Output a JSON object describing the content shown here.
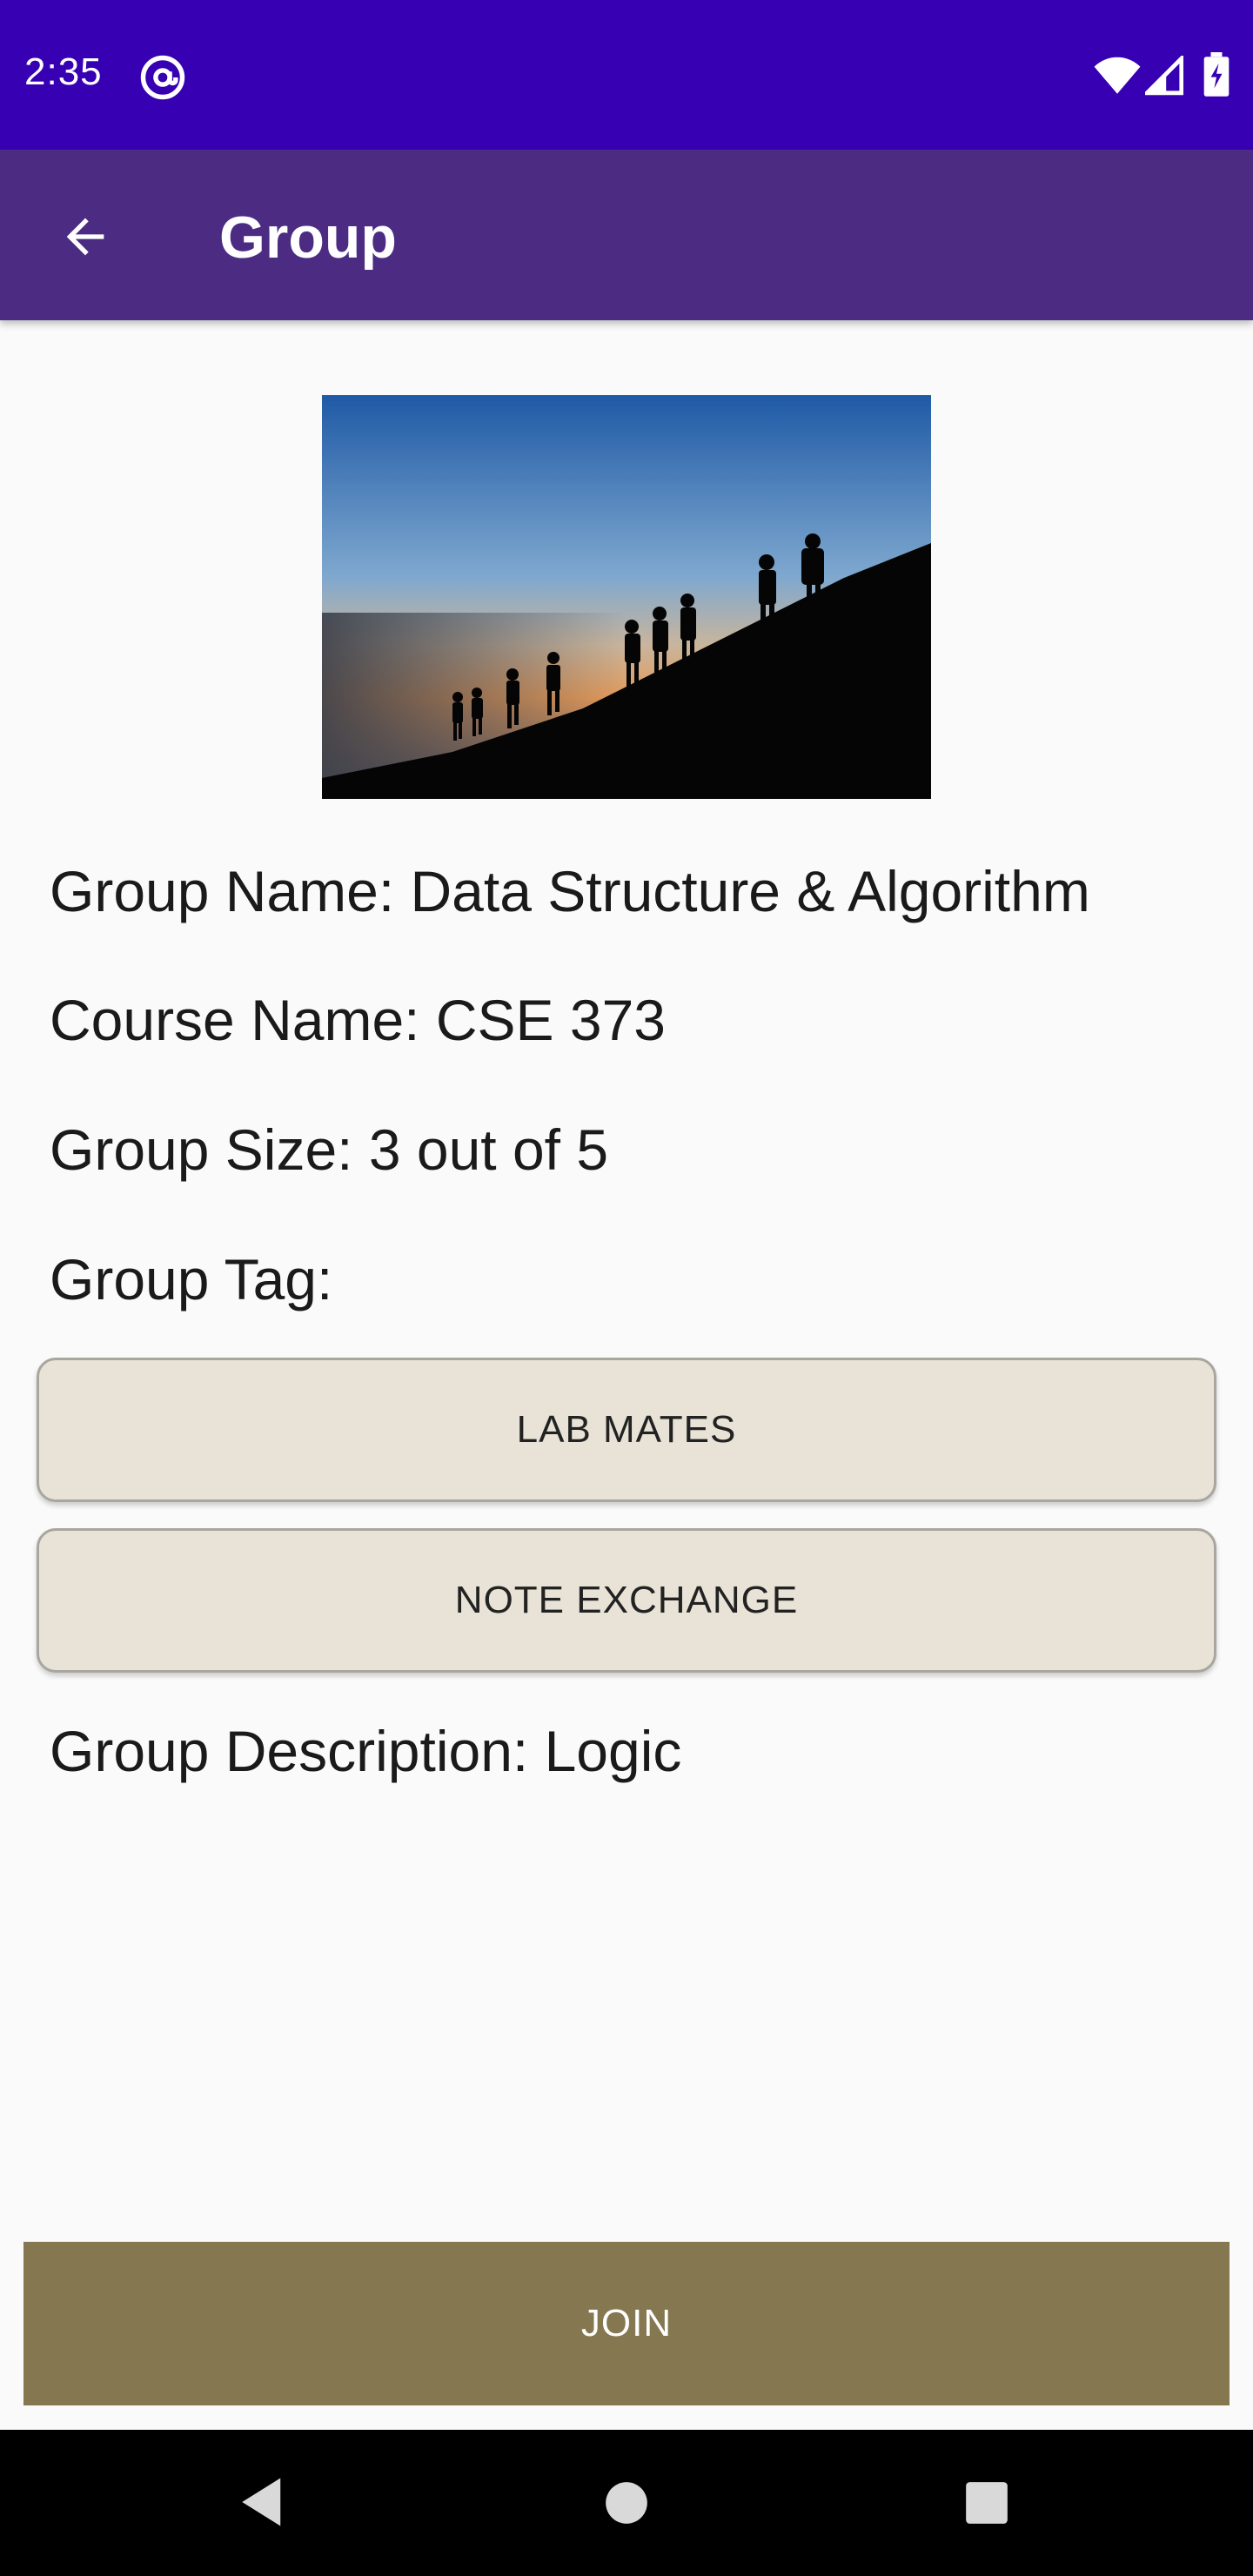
{
  "status_bar": {
    "time": "2:35",
    "icons": [
      "at-sign-icon",
      "wifi-icon",
      "signal-icon",
      "battery-icon"
    ]
  },
  "app_bar": {
    "title": "Group",
    "back_icon": "arrow-left-icon"
  },
  "group": {
    "image": "hikers-silhouette-photo",
    "name_line": "Group Name: Data Structure & Algorithm",
    "course_line": "Course Name: CSE 373",
    "size_line": "Group Size: 3 out of 5",
    "tag_heading": "Group Tag:",
    "tags": [
      "LAB MATES",
      "NOTE EXCHANGE"
    ],
    "description_line": "Group Description: Logic"
  },
  "actions": {
    "join_label": "JOIN"
  },
  "nav_bar": {
    "icons": [
      "back-triangle-icon",
      "home-circle-icon",
      "recents-square-icon"
    ]
  },
  "colors": {
    "status_bar": "#3700b3",
    "app_bar": "#4c2c82",
    "tag_button": "#e8e3d6",
    "join_button": "#85774f"
  }
}
